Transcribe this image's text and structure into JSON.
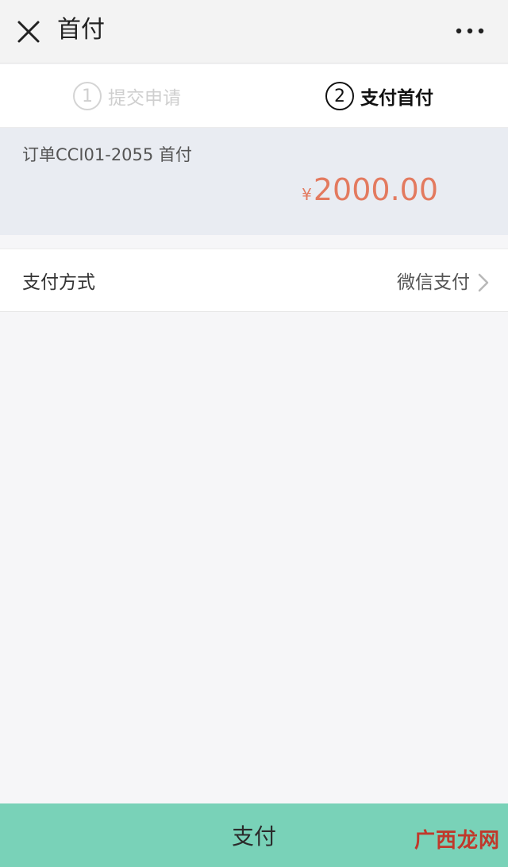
{
  "header": {
    "title": "首付",
    "close_icon": "close-icon",
    "more_icon": "more-horizontal-icon"
  },
  "steps": [
    {
      "number": "1",
      "label": "提交申请",
      "state": "inactive"
    },
    {
      "number": "2",
      "label": "支付首付",
      "state": "active"
    }
  ],
  "order": {
    "title": "订单CCI01-2055  首付",
    "currency": "¥",
    "amount": "2000.00",
    "amount_color": "#e37a5f"
  },
  "payment_method": {
    "label": "支付方式",
    "value": "微信支付",
    "chevron_icon": "chevron-right-icon"
  },
  "pay_button": {
    "label": "支付",
    "color": "#79d2b8"
  },
  "watermark": {
    "text": "广西龙网"
  }
}
